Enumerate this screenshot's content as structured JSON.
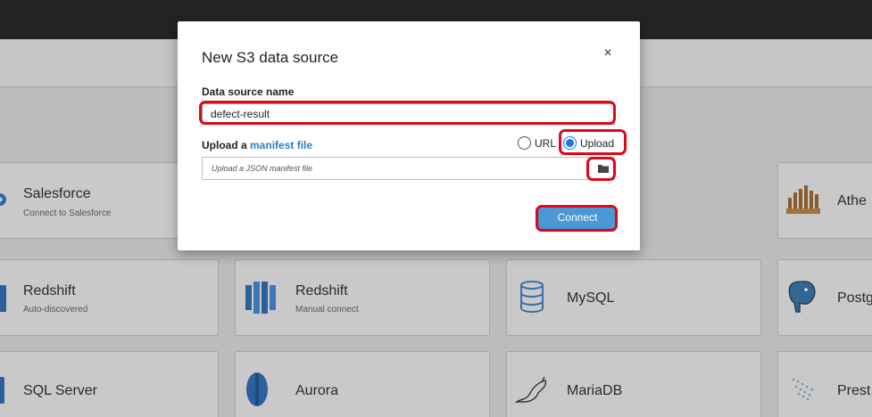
{
  "modal": {
    "title": "New S3 data source",
    "close_label": "×",
    "name_label": "Data source name",
    "name_value": "defect-result",
    "upload_label_prefix": "Upload a ",
    "upload_label_link": "manifest file",
    "radio_url_label": "URL",
    "radio_upload_label": "Upload",
    "selected_option": "Upload",
    "file_placeholder": "Upload a JSON manifest file",
    "connect_label": "Connect"
  },
  "cards": [
    {
      "title": "Salesforce",
      "subtitle": "Connect to Salesforce",
      "icon": "salesforce-icon"
    },
    {
      "title": "Athe",
      "subtitle": "",
      "icon": "athena-icon"
    },
    {
      "title": "Redshift",
      "subtitle": "Auto-discovered",
      "icon": "redshift-icon"
    },
    {
      "title": "Redshift",
      "subtitle": "Manual connect",
      "icon": "redshift-icon"
    },
    {
      "title": "MySQL",
      "subtitle": "",
      "icon": "mysql-icon"
    },
    {
      "title": "Postg",
      "subtitle": "",
      "icon": "postgresql-icon"
    },
    {
      "title": "SQL Server",
      "subtitle": "",
      "icon": "sql-server-icon"
    },
    {
      "title": "Aurora",
      "subtitle": "",
      "icon": "aurora-icon"
    },
    {
      "title": "MariaDB",
      "subtitle": "",
      "icon": "mariadb-icon"
    },
    {
      "title": "Prest",
      "subtitle": "",
      "icon": "presto-icon"
    }
  ],
  "colors": {
    "highlight": "#e0061b",
    "accent": "#4c97d6",
    "link": "#2f7fc1"
  }
}
